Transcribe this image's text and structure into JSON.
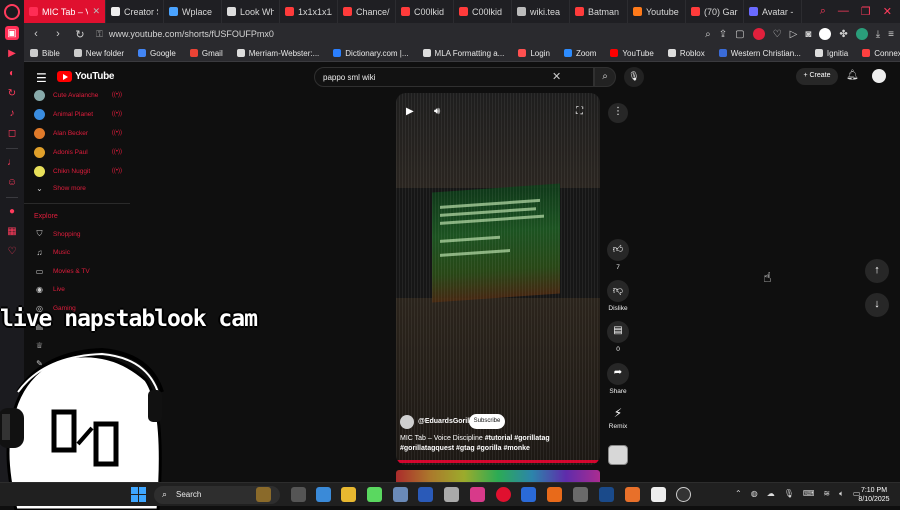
{
  "browser": {
    "tabs": [
      {
        "title": "MIC Tab – Voice D",
        "color": "#ff2d55",
        "active": true
      },
      {
        "title": "Creator S",
        "color": "#eeeeee"
      },
      {
        "title": "Wplace",
        "color": "#4aa3ff"
      },
      {
        "title": "Look Wh",
        "color": "#dddddd"
      },
      {
        "title": "1x1x1x1/",
        "color": "#ff3b3b"
      },
      {
        "title": "Chance/",
        "color": "#ff3b3b"
      },
      {
        "title": "C00lkid",
        "color": "#ff3b3b"
      },
      {
        "title": "C00lkid",
        "color": "#ff3b3b"
      },
      {
        "title": "wiki.tea",
        "color": "#bbbbbb"
      },
      {
        "title": "Batman",
        "color": "#ff3b3b"
      },
      {
        "title": "Youtube",
        "color": "#ff7a1a"
      },
      {
        "title": "(70) Gar",
        "color": "#ff3b3b"
      },
      {
        "title": "Avatar - ",
        "color": "#6a6aff"
      }
    ],
    "url": "www.youtube.com/shorts/fUSFOUFPmx0",
    "bookmarks": [
      {
        "label": "Bible",
        "color": "#cccccc"
      },
      {
        "label": "New folder",
        "color": "#cccccc"
      },
      {
        "label": "Google",
        "color": "#4285f4"
      },
      {
        "label": "Gmail",
        "color": "#ea4335"
      },
      {
        "label": "Merriam-Webster:...",
        "color": "#dddddd"
      },
      {
        "label": "Dictionary.com |...",
        "color": "#2a7fff"
      },
      {
        "label": "MLA Formatting a...",
        "color": "#dddddd"
      },
      {
        "label": "Login",
        "color": "#ff5050"
      },
      {
        "label": "Zoom",
        "color": "#2d8cff"
      },
      {
        "label": "YouTube",
        "color": "#ff0000"
      },
      {
        "label": "Roblox",
        "color": "#dddddd"
      },
      {
        "label": "Western Christian...",
        "color": "#3a6bd8"
      },
      {
        "label": "Ignitia",
        "color": "#dddddd"
      },
      {
        "label": "Connexus",
        "color": "#ff4040"
      }
    ]
  },
  "youtube": {
    "logo_text": "YouTube",
    "search_value": "pappo sml wiki",
    "create_label": "+ Create",
    "subscriptions": [
      {
        "name": "Cute Avalanche",
        "color": "#8aa"
      },
      {
        "name": "Animal Planet",
        "color": "#3a8de0"
      },
      {
        "name": "Alan Becker",
        "color": "#e07a2a"
      },
      {
        "name": "Adonis Paul",
        "color": "#e0a02a"
      },
      {
        "name": "Chikn Nuggit",
        "color": "#e8e05a"
      }
    ],
    "live_label": "((•))",
    "show_more": "Show more",
    "explore_heading": "Explore",
    "explore": [
      {
        "name": "Shopping",
        "icon": "shopping-bag-icon",
        "glyph": "⛉"
      },
      {
        "name": "Music",
        "icon": "music-note-icon",
        "glyph": "♫"
      },
      {
        "name": "Movies & TV",
        "icon": "film-icon",
        "glyph": "▭"
      },
      {
        "name": "Live",
        "icon": "live-icon",
        "glyph": "◉"
      },
      {
        "name": "Gaming",
        "icon": "gaming-icon",
        "glyph": "◎"
      },
      {
        "name": "",
        "icon": "news-icon",
        "glyph": "▤"
      },
      {
        "name": "",
        "icon": "trophy-icon",
        "glyph": "♕"
      },
      {
        "name": "Learning",
        "icon": "learning-icon",
        "glyph": "✎"
      },
      {
        "name": "",
        "icon": "hanger-icon",
        "glyph": "⌂"
      }
    ]
  },
  "short": {
    "channel": "@EduardsGorilla",
    "subscribe_label": "Subscribe",
    "title_plain": "MIC Tab – Voice Discipline ",
    "title_tags": "#tutorial #gorillatag #gorillatagquest #gtag #gorilla #monke",
    "likes": "7",
    "dislike_label": "Dislike",
    "comments": "0",
    "share_label": "Share",
    "remix_label": "Remix"
  },
  "overlay": {
    "stream_text": "live napstablook cam"
  },
  "taskbar": {
    "search_label": "Search",
    "time": "7:10 PM",
    "date": "8/10/2025"
  }
}
